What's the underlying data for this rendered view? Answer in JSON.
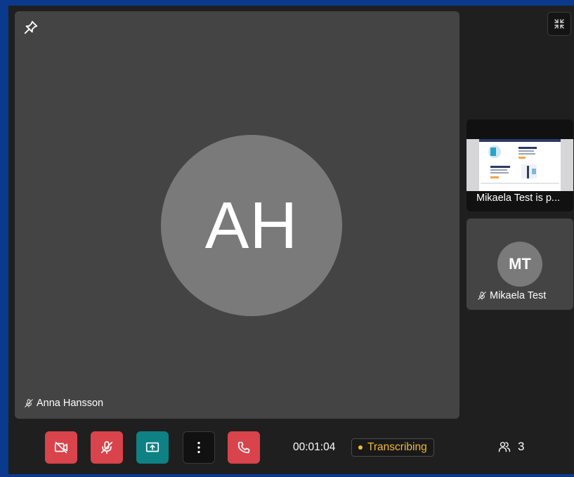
{
  "main_participant": {
    "initials": "AH",
    "name": "Anna Hansson",
    "muted": true
  },
  "sidebar": {
    "screen_share": {
      "label": "Mikaela Test is p..."
    },
    "participant": {
      "initials": "MT",
      "name": "Mikaela Test",
      "muted": true
    }
  },
  "toolbar": {
    "camera_icon": "camera-off-icon",
    "mic_icon": "mic-off-icon",
    "share_icon": "share-screen-icon",
    "more_icon": "more-vertical-icon",
    "hangup_icon": "phone-hangup-icon",
    "timer": "00:01:04",
    "transcribing_label": "Transcribing",
    "participants_count": "3"
  },
  "colors": {
    "background": "#1f1f1f",
    "tile": "#444444",
    "avatar": "#7a7a7a",
    "danger": "#d9434b",
    "teal": "#0e8184",
    "transcribing": "#f0b93a",
    "window_border": "#0b3a8c"
  }
}
